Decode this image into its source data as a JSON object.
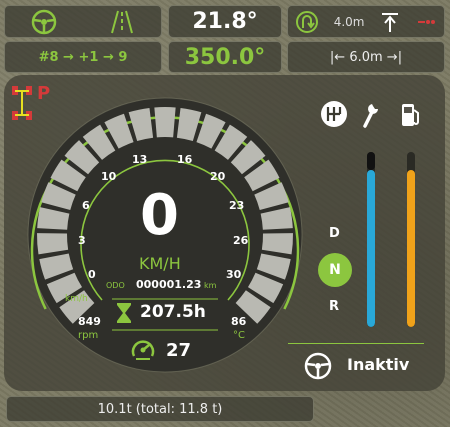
{
  "top_left": {
    "steer_icon": "steering-wheel-icon",
    "lane_icon": "track-icon",
    "lane_sequence": "#8 → +1 → 9"
  },
  "top_center": {
    "angle1": "21.8°",
    "angle2": "350.0°"
  },
  "top_right": {
    "turn_icon": "u-turn-icon",
    "turn_distance": "4.0m",
    "lift_icon": "lift-arrow-icon",
    "width_label": "|← 6.0m →|"
  },
  "status": {
    "parking_brake": "P",
    "axle_icon": "axle-icon"
  },
  "speedometer": {
    "speed": "0",
    "unit": "KM/H",
    "kmh_label": "km/h",
    "ticks": [
      "0",
      "3",
      "6",
      "10",
      "13",
      "16",
      "20",
      "23",
      "26",
      "30"
    ],
    "odo_label": "ODO",
    "odo_value": "000001.23",
    "odo_unit": "km",
    "hours": "207.5h",
    "rpm_value": "849",
    "rpm_unit": "rpm",
    "temp_value": "86",
    "temp_unit": "°C",
    "cruise_value": "27"
  },
  "right": {
    "gear_icon": "gearshift-icon",
    "wrench_icon": "wrench-icon",
    "fuel_icon": "fuel-pump-icon",
    "gears": [
      "D",
      "N",
      "R"
    ],
    "active_gear": "N",
    "diesel_level": 0.9,
    "def_level": 0.9,
    "autosteer_label": "Inaktiv"
  },
  "bottom": {
    "load": "10.1t (total: 11.8 t)"
  },
  "colors": {
    "accent": "#8cc63f",
    "diesel": "#29a8d8",
    "def": "#f0a21a"
  }
}
